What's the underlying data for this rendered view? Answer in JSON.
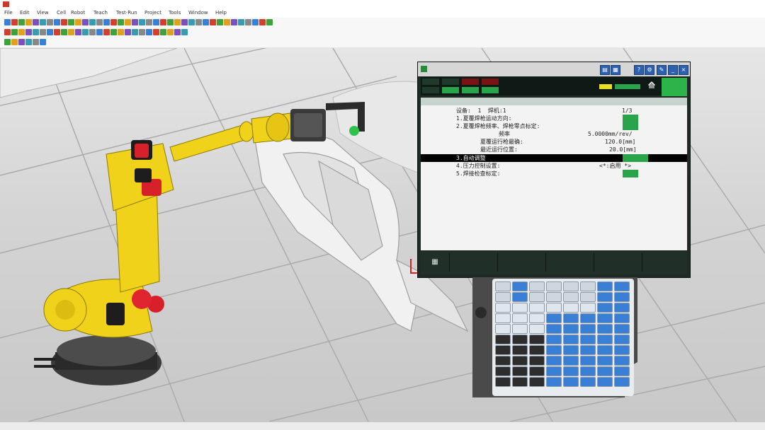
{
  "window": {
    "title": ""
  },
  "menu": [
    "File",
    "Edit",
    "View",
    "Cell",
    "Robot",
    "Teach",
    "Test-Run",
    "Project",
    "Tools",
    "Window",
    "Help"
  ],
  "colors": {
    "robot_yellow": "#f0d21a",
    "robot_red": "#d8202a",
    "floor": "#cfcfcf",
    "pendant_green": "#2aa44a",
    "pendant_dark": "#1d2b24",
    "key_blue": "#3a7fd6"
  },
  "pendant": {
    "title": "",
    "status_tags": [
      "",
      "",
      "",
      "",
      "",
      "",
      "",
      ""
    ],
    "screen_header": "",
    "line0": {
      "label": "设备:  1  焊机:1",
      "value": "1/3"
    },
    "line1": {
      "label": "1.夏覆焊枪运动方向:",
      "value": ""
    },
    "line2": {
      "label": "2.夏覆焊枪频率、焊枪零点标定:",
      "value": ""
    },
    "line2a": {
      "label": "频率",
      "value": "5.0000mm/rev/"
    },
    "line2b": {
      "label": "夏覆运行枪最确:",
      "value": "120.0[mm]"
    },
    "line2c": {
      "label": "最近运行位置:",
      "value": "20.0[mm]"
    },
    "line3": {
      "label": "3.自动调整",
      "value": ""
    },
    "line4": {
      "label": "4.压力控制设置:",
      "value": "<*:启用 *>"
    },
    "line5": {
      "label": "5.焊接检查标定:",
      "value": ""
    },
    "fkeys": [
      "▦",
      "",
      "",
      "",
      "",
      ""
    ]
  },
  "statusbar": {
    "left": "",
    "mid": "",
    "right": ""
  }
}
